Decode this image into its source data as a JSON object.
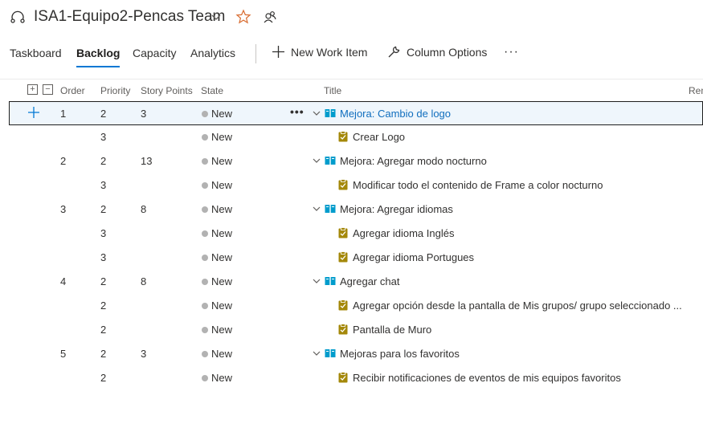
{
  "header": {
    "team_name": "ISA1-Equipo2-Pencas Team"
  },
  "tabs": [
    {
      "label": "Taskboard",
      "active": false
    },
    {
      "label": "Backlog",
      "active": true
    },
    {
      "label": "Capacity",
      "active": false
    },
    {
      "label": "Analytics",
      "active": false
    }
  ],
  "commands": {
    "new_work_item": "New Work Item",
    "column_options": "Column Options",
    "more": "···"
  },
  "columns": {
    "order": "Order",
    "priority": "Priority",
    "story_points": "Story Points",
    "state": "State",
    "title": "Title",
    "remaining": "Rem"
  },
  "colors": {
    "accent": "#0078d4",
    "story_icon": "#009ccc",
    "task_icon": "#a4880a",
    "state_new": "#b2b2b2",
    "selected_row_bg": "#eff6fc"
  },
  "rows": [
    {
      "order": "1",
      "priority": "2",
      "points": "3",
      "state": "New",
      "title": "Mejora: Cambio de logo",
      "kind": "story",
      "selected": true
    },
    {
      "order": "",
      "priority": "3",
      "points": "",
      "state": "New",
      "title": "Crear Logo",
      "kind": "task"
    },
    {
      "order": "2",
      "priority": "2",
      "points": "13",
      "state": "New",
      "title": "Mejora: Agregar modo nocturno",
      "kind": "story"
    },
    {
      "order": "",
      "priority": "3",
      "points": "",
      "state": "New",
      "title": "Modificar todo el contenido de Frame a color nocturno",
      "kind": "task"
    },
    {
      "order": "3",
      "priority": "2",
      "points": "8",
      "state": "New",
      "title": "Mejora: Agregar idiomas",
      "kind": "story"
    },
    {
      "order": "",
      "priority": "3",
      "points": "",
      "state": "New",
      "title": "Agregar idioma Inglés",
      "kind": "task"
    },
    {
      "order": "",
      "priority": "3",
      "points": "",
      "state": "New",
      "title": "Agregar idioma Portugues",
      "kind": "task"
    },
    {
      "order": "4",
      "priority": "2",
      "points": "8",
      "state": "New",
      "title": "Agregar chat",
      "kind": "story"
    },
    {
      "order": "",
      "priority": "2",
      "points": "",
      "state": "New",
      "title": "Agregar opción desde la pantalla de Mis grupos/ grupo seleccionado ...",
      "kind": "task"
    },
    {
      "order": "",
      "priority": "2",
      "points": "",
      "state": "New",
      "title": "Pantalla de Muro",
      "kind": "task"
    },
    {
      "order": "5",
      "priority": "2",
      "points": "3",
      "state": "New",
      "title": "Mejoras para los favoritos",
      "kind": "story"
    },
    {
      "order": "",
      "priority": "2",
      "points": "",
      "state": "New",
      "title": "Recibir notificaciones de eventos de mis equipos favoritos",
      "kind": "task"
    }
  ]
}
